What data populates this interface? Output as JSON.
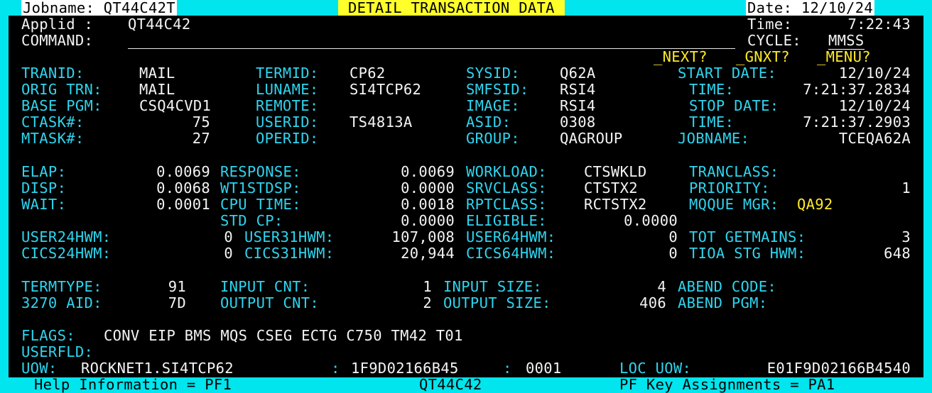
{
  "header": {
    "jobname": "Jobname: QT44C42T",
    "title": "DETAIL TRANSACTION DATA",
    "date": "Date: 12/10/24"
  },
  "top": {
    "applid_label": "Applid :",
    "applid_value": "QT44C42",
    "time_label": "Time:",
    "time_value": "7:22:43",
    "command_label": "COMMAND:",
    "command_value": "",
    "cycle_label": "CYCLE:",
    "cycle_value": "MMSS",
    "next": "_NEXT?",
    "gnxt": "_GNXT?",
    "menu": "_MENU?"
  },
  "block1": {
    "tranid_label": "TRANID:",
    "tranid_value": "MAIL",
    "origtrn_label": "ORIG TRN:",
    "origtrn_value": "MAIL",
    "basepgm_label": "BASE PGM:",
    "basepgm_value": "CSQ4CVD1",
    "ctask_label": "CTASK#:",
    "ctask_value": "75",
    "mtask_label": "MTASK#:",
    "mtask_value": "27",
    "termid_label": "TERMID:",
    "termid_value": "CP62",
    "luname_label": "LUNAME:",
    "luname_value": "SI4TCP62",
    "remote_label": "REMOTE:",
    "userid_label": "USERID:",
    "userid_value": "TS4813A",
    "operid_label": "OPERID:",
    "sysid_label": "SYSID:",
    "sysid_value": "Q62A",
    "smfsid_label": "SMFSID:",
    "smfsid_value": "RSI4",
    "image_label": "IMAGE:",
    "image_value": "RSI4",
    "asid_label": "ASID:",
    "asid_value": "0308",
    "group_label": "GROUP:",
    "group_value": "QAGROUP",
    "startdate_label": "START DATE:",
    "startdate_value": "12/10/24",
    "time1_label": "TIME:",
    "time1_value": "7:21:37.2834",
    "stopdate_label": "STOP DATE:",
    "stopdate_value": "12/10/24",
    "time2_label": "TIME:",
    "time2_value": "7:21:37.2903",
    "jobname_label": "JOBNAME:",
    "jobname_value": "TCEQA62A"
  },
  "block2": {
    "elap_label": "ELAP:",
    "elap_value": "0.0069",
    "disp_label": "DISP:",
    "disp_value": "0.0068",
    "wait_label": "WAIT:",
    "wait_value": "0.0001",
    "response_label": "RESPONSE:",
    "response_value": "0.0069",
    "wt1stdsp_label": "WT1STDSP:",
    "wt1stdsp_value": "0.0000",
    "cputime_label": "CPU TIME:",
    "cputime_value": "0.0018",
    "stdcp_label": "STD CP:",
    "stdcp_value": "0.0000",
    "workload_label": "WORKLOAD:",
    "workload_value": "CTSWKLD",
    "srvclass_label": "SRVCLASS:",
    "srvclass_value": "CTSTX2",
    "rptclass_label": "RPTCLASS:",
    "rptclass_value": "RCTSTX2",
    "eligible_label": "ELIGIBLE:",
    "eligible_value": "0.0000",
    "tranclass_label": "TRANCLASS:",
    "priority_label": "PRIORITY:",
    "priority_value": "1",
    "mqque_label": "MQQUE MGR:",
    "mqque_value": "QA92"
  },
  "block3": {
    "user24_label": "USER24HWM:",
    "user24_value": "0",
    "cics24_label": "CICS24HWM:",
    "cics24_value": "0",
    "user31_label": "USER31HWM:",
    "user31_value": "107,008",
    "cics31_label": "CICS31HWM:",
    "cics31_value": "20,944",
    "user64_label": "USER64HWM:",
    "user64_value": "0",
    "cics64_label": "CICS64HWM:",
    "cics64_value": "0",
    "totget_label": "TOT GETMAINS:",
    "totget_value": "3",
    "tioa_label": "TIOA STG HWM:",
    "tioa_value": "648"
  },
  "block4": {
    "termtype_label": "TERMTYPE:",
    "termtype_value": "91",
    "aid_label": "3270 AID:",
    "aid_value": "7D",
    "inputcnt_label": "INPUT CNT:",
    "inputcnt_value": "1",
    "outputcnt_label": "OUTPUT CNT:",
    "outputcnt_value": "2",
    "inputsize_label": "INPUT SIZE:",
    "inputsize_value": "4",
    "outputsize_label": "OUTPUT SIZE:",
    "outputsize_value": "406",
    "abendcode_label": "ABEND CODE:",
    "abendpgm_label": "ABEND PGM:"
  },
  "block5": {
    "flags_label": "FLAGS:",
    "flags_value": "CONV EIP BMS MQS CSEG ECTG C750 TM42 T01",
    "userfld_label": "USERFLD:",
    "uow_label": "UOW:",
    "uow_value": "ROCKNET1.SI4TCP62",
    "uow_sep1": ":",
    "uow_part2": "1F9D02166B45",
    "uow_sep2": ":",
    "uow_part3": "0001",
    "locuow_label": "LOC UOW:",
    "locuow_value": "E01F9D02166B4540"
  },
  "footer": {
    "help": "Help Information = PF1",
    "applid": "QT44C42",
    "pfkeys": "PF Key Assignments = PA1"
  },
  "colors": {
    "frame": "#00e5ee",
    "background": "#000000",
    "label": "#2ed5ef",
    "value": "#f4f4f4",
    "highlight": "#ffea2a"
  }
}
